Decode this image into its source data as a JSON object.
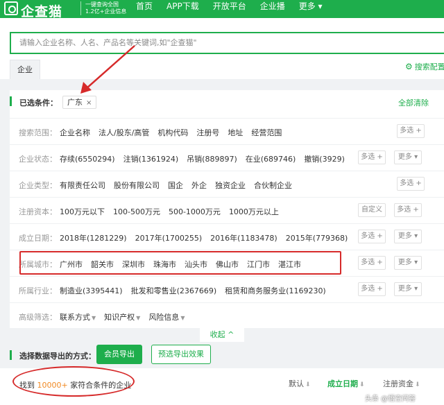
{
  "header": {
    "brand": "企查猫",
    "slogan_line1": "一键查询全国",
    "slogan_line2": "1.2亿+企业信息",
    "nav": [
      "首页",
      "APP下载",
      "开放平台",
      "企业播",
      "更多 ▾"
    ]
  },
  "search": {
    "placeholder": "请输入企业名称、人名、产品名等关键词,如\"企查猫\"",
    "tab": "企业",
    "config_label": "搜索配置"
  },
  "filters": {
    "selected_label": "已选条件：",
    "selected_chip": "广东",
    "chip_close": "×",
    "clear_all": "全部清除",
    "multi_label": "多选 +",
    "more_label": "更多 ▾",
    "custom_label": "自定义",
    "rows": [
      {
        "label": "搜索范围：",
        "options": [
          "企业名称",
          "法人/股东/高管",
          "机构代码",
          "注册号",
          "地址",
          "经营范围"
        ]
      },
      {
        "label": "企业状态：",
        "options": [
          "存续(6550294)",
          "注销(1361924)",
          "吊销(889897)",
          "在业(689746)",
          "撤销(3929)"
        ]
      },
      {
        "label": "企业类型：",
        "options": [
          "有限责任公司",
          "股份有限公司",
          "国企",
          "外企",
          "独资企业",
          "合伙制企业"
        ]
      },
      {
        "label": "注册资本：",
        "options": [
          "100万元以下",
          "100-500万元",
          "500-1000万元",
          "1000万元以上"
        ]
      },
      {
        "label": "成立日期：",
        "options": [
          "2018年(1281229)",
          "2017年(1700255)",
          "2016年(1183478)",
          "2015年(779368)"
        ]
      },
      {
        "label": "所属城市：",
        "options": [
          "广州市",
          "韶关市",
          "深圳市",
          "珠海市",
          "汕头市",
          "佛山市",
          "江门市",
          "湛江市"
        ]
      },
      {
        "label": "所属行业：",
        "options": [
          "制造业(3395441)",
          "批发和零售业(2367669)",
          "租赁和商务服务业(1169230)"
        ]
      }
    ],
    "advanced_label": "高级筛选：",
    "advanced_options": [
      "联系方式",
      "知识产权",
      "风险信息"
    ],
    "collapse": "收起 ^"
  },
  "export": {
    "label": "选择数据导出的方式：",
    "member_button": "会员导出",
    "preview_button": "预选导出效果"
  },
  "results": {
    "prefix": "找到",
    "count": "10000+",
    "suffix": "家符合条件的企业",
    "sort_default": "默认",
    "sort_established": "成立日期",
    "sort_capital": "注册资金"
  },
  "watermark": "头条 @悟空问答",
  "colors": {
    "brand_green": "#1eae4c",
    "highlight_red": "#d62a2a",
    "count_orange": "#f08a24"
  }
}
